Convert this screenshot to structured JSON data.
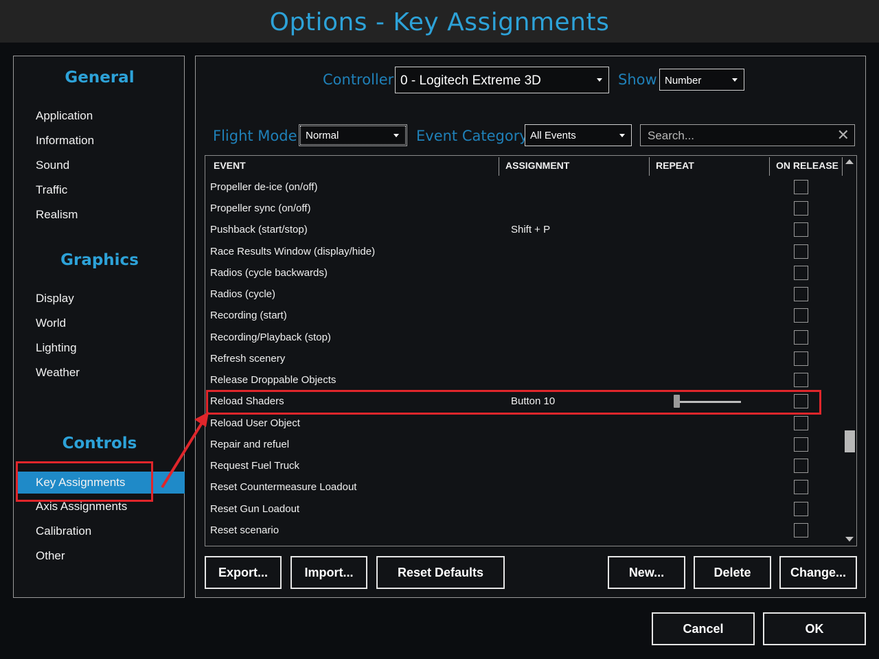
{
  "window": {
    "title": "Options - Key Assignments"
  },
  "sidebar": {
    "sections": [
      {
        "title": "General",
        "items": [
          "Application",
          "Information",
          "Sound",
          "Traffic",
          "Realism"
        ]
      },
      {
        "title": "Graphics",
        "items": [
          "Display",
          "World",
          "Lighting",
          "Weather"
        ]
      },
      {
        "title": "Controls",
        "items": [
          "Key Assignments",
          "Axis Assignments",
          "Calibration",
          "Other"
        ]
      }
    ],
    "active_item": "Key Assignments"
  },
  "filters": {
    "controller_label": "Controller",
    "controller_value": "0 - Logitech Extreme 3D",
    "show_label": "Show",
    "show_value": "Number",
    "flight_mode_label": "Flight Mode",
    "flight_mode_value": "Normal",
    "event_category_label": "Event Category",
    "event_category_value": "All Events",
    "search_placeholder": "Search..."
  },
  "table": {
    "columns": [
      "EVENT",
      "ASSIGNMENT",
      "REPEAT",
      "ON RELEASE"
    ],
    "rows": [
      {
        "event": "Propeller de-ice (on/off)",
        "assignment": ""
      },
      {
        "event": "Propeller sync (on/off)",
        "assignment": ""
      },
      {
        "event": "Pushback (start/stop)",
        "assignment": "Shift + P"
      },
      {
        "event": "Race Results Window (display/hide)",
        "assignment": ""
      },
      {
        "event": "Radios (cycle backwards)",
        "assignment": ""
      },
      {
        "event": "Radios (cycle)",
        "assignment": ""
      },
      {
        "event": "Recording (start)",
        "assignment": ""
      },
      {
        "event": "Recording/Playback (stop)",
        "assignment": ""
      },
      {
        "event": "Refresh scenery",
        "assignment": ""
      },
      {
        "event": "Release Droppable Objects",
        "assignment": ""
      },
      {
        "event": "Reload Shaders",
        "assignment": "Button 10",
        "repeat_level": 0
      },
      {
        "event": "Reload User Object",
        "assignment": ""
      },
      {
        "event": "Repair and refuel",
        "assignment": ""
      },
      {
        "event": "Request Fuel Truck",
        "assignment": ""
      },
      {
        "event": "Reset Countermeasure Loadout",
        "assignment": ""
      },
      {
        "event": "Reset Gun Loadout",
        "assignment": ""
      },
      {
        "event": "Reset scenario",
        "assignment": ""
      }
    ]
  },
  "buttons": {
    "export": "Export...",
    "import": "Import...",
    "reset_defaults": "Reset Defaults",
    "new": "New...",
    "delete": "Delete",
    "change": "Change...",
    "cancel": "Cancel",
    "ok": "OK"
  },
  "colors": {
    "accent": "#2da2d8",
    "active_nav": "#1f8ac8",
    "annotation": "#e0262b"
  }
}
